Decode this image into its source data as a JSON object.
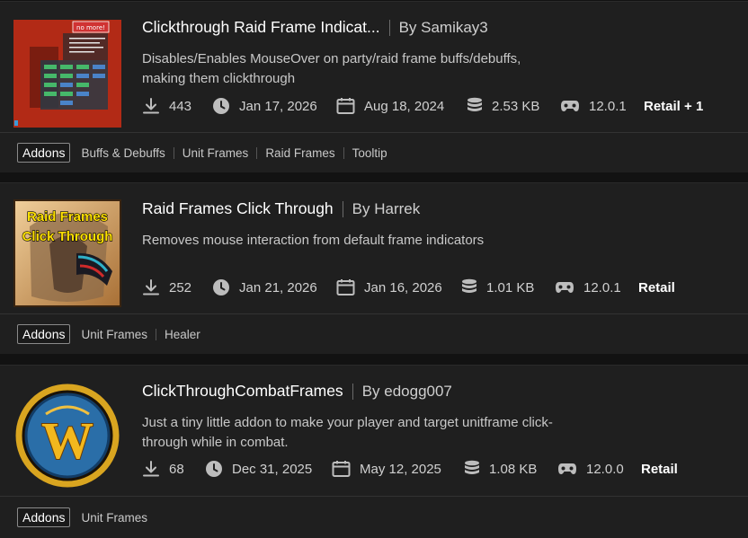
{
  "addons": [
    {
      "title": "Clickthrough Raid Frame Indicat...",
      "author": "By Samikay3",
      "description": "Disables/Enables MouseOver on party/raid frame buffs/debuffs, making them clickthrough",
      "downloads": "443",
      "updated": "Jan 17, 2026",
      "created": "Aug 18, 2024",
      "size": "2.53 KB",
      "version": "12.0.1",
      "game_version": "Retail + 1",
      "thumbnail_text": "no more!",
      "category": "Addons",
      "tags": [
        "Buffs & Debuffs",
        "Unit Frames",
        "Raid Frames",
        "Tooltip"
      ]
    },
    {
      "title": "Raid Frames Click Through",
      "author": "By Harrek",
      "description": "Removes mouse interaction from default frame indicators",
      "downloads": "252",
      "updated": "Jan 21, 2026",
      "created": "Jan 16, 2026",
      "size": "1.01 KB",
      "version": "12.0.1",
      "game_version": "Retail",
      "thumbnail_text_line1": "Raid Frames",
      "thumbnail_text_line2": "Click Through",
      "category": "Addons",
      "tags": [
        "Unit Frames",
        "Healer"
      ]
    },
    {
      "title": "ClickThroughCombatFrames",
      "author": "By edogg007",
      "description": "Just a tiny little addon to make your player and target unitframe click-through while in combat.",
      "downloads": "68",
      "updated": "Dec 31, 2025",
      "created": "May 12, 2025",
      "size": "1.08 KB",
      "version": "12.0.0",
      "game_version": "Retail",
      "thumbnail_text": "W",
      "category": "Addons",
      "tags": [
        "Unit Frames"
      ]
    }
  ],
  "icons": {
    "downloads": "download-icon",
    "updated": "clock-icon",
    "created": "calendar-icon",
    "size": "database-icon",
    "game": "gamepad-icon"
  },
  "colors": {
    "background": "#121212",
    "card": "#1f1f1f",
    "title": "#ffffff",
    "muted": "#c8c8c8",
    "wow_gold": "#d9a520"
  }
}
